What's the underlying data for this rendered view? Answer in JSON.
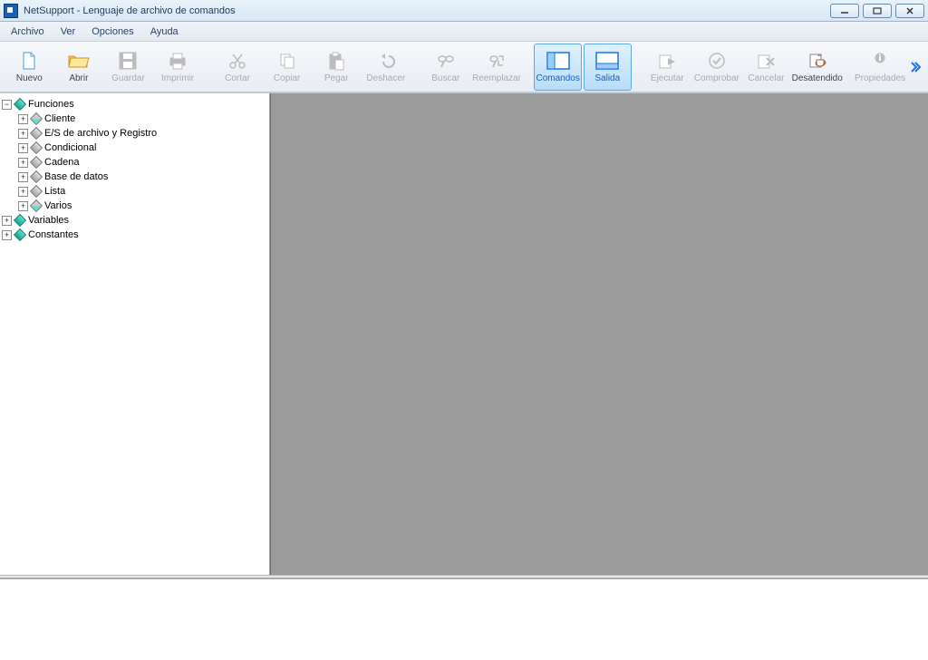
{
  "title": "NetSupport - Lenguaje de archivo de comandos",
  "menus": [
    "Archivo",
    "Ver",
    "Opciones",
    "Ayuda"
  ],
  "toolbar": [
    {
      "id": "nuevo",
      "label": "Nuevo",
      "enabled": true,
      "icon": "file"
    },
    {
      "id": "abrir",
      "label": "Abrir",
      "enabled": true,
      "icon": "folder"
    },
    {
      "id": "guardar",
      "label": "Guardar",
      "enabled": false,
      "icon": "save"
    },
    {
      "id": "imprimir",
      "label": "Imprimir",
      "enabled": false,
      "icon": "print"
    },
    {
      "id": "sp1",
      "spacer": true
    },
    {
      "id": "cortar",
      "label": "Cortar",
      "enabled": false,
      "icon": "cut"
    },
    {
      "id": "copiar",
      "label": "Copiar",
      "enabled": false,
      "icon": "copy"
    },
    {
      "id": "pegar",
      "label": "Pegar",
      "enabled": false,
      "icon": "paste"
    },
    {
      "id": "deshacer",
      "label": "Deshacer",
      "enabled": false,
      "icon": "undo"
    },
    {
      "id": "sp2",
      "spacer": true
    },
    {
      "id": "buscar",
      "label": "Buscar",
      "enabled": false,
      "icon": "find"
    },
    {
      "id": "reemplazar",
      "label": "Reemplazar",
      "enabled": false,
      "icon": "replace"
    },
    {
      "id": "sp3",
      "spacer": true
    },
    {
      "id": "comandos",
      "label": "Comandos",
      "enabled": true,
      "active": true,
      "icon": "window"
    },
    {
      "id": "salida",
      "label": "Salida",
      "enabled": true,
      "active": true,
      "icon": "window2"
    },
    {
      "id": "sp4",
      "spacer": true
    },
    {
      "id": "ejecutar",
      "label": "Ejecutar",
      "enabled": false,
      "icon": "run"
    },
    {
      "id": "comprobar",
      "label": "Comprobar",
      "enabled": false,
      "icon": "check"
    },
    {
      "id": "cancelar",
      "label": "Cancelar",
      "enabled": false,
      "icon": "cancel"
    },
    {
      "id": "desatendido",
      "label": "Desatendido",
      "enabled": true,
      "icon": "coffee"
    },
    {
      "id": "sp5",
      "spacer": true
    },
    {
      "id": "propiedades",
      "label": "Propiedades",
      "enabled": false,
      "icon": "props"
    }
  ],
  "tree": {
    "root": {
      "label": "Funciones",
      "expanded": true,
      "glyph": "teal",
      "children": [
        {
          "label": "Cliente",
          "glyph": "half"
        },
        {
          "label": "E/S de archivo y Registro",
          "glyph": "grey"
        },
        {
          "label": "Condicional",
          "glyph": "grey"
        },
        {
          "label": "Cadena",
          "glyph": "grey"
        },
        {
          "label": "Base de datos",
          "glyph": "grey"
        },
        {
          "label": "Lista",
          "glyph": "grey"
        },
        {
          "label": "Varios",
          "glyph": "half"
        }
      ]
    },
    "siblings": [
      {
        "label": "Variables",
        "glyph": "teal"
      },
      {
        "label": "Constantes",
        "glyph": "teal"
      }
    ]
  }
}
